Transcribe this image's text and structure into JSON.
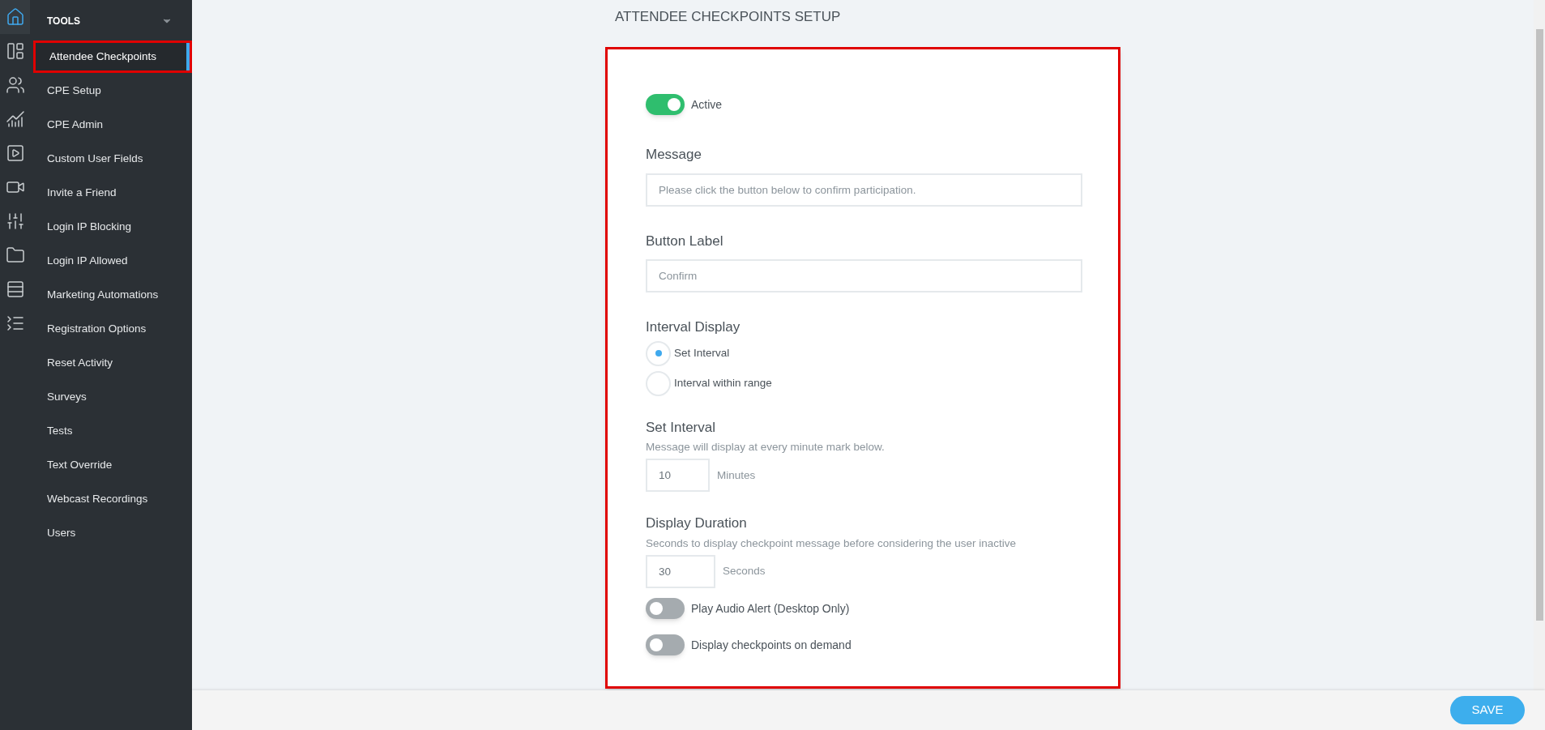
{
  "icon_rail": [
    {
      "kind": "home",
      "selected": true
    },
    {
      "kind": "layout",
      "selected": false
    },
    {
      "kind": "users",
      "selected": false
    },
    {
      "kind": "chart",
      "selected": false
    },
    {
      "kind": "media",
      "selected": false
    },
    {
      "kind": "video",
      "selected": false
    },
    {
      "kind": "sliders",
      "selected": false
    },
    {
      "kind": "folder",
      "selected": false
    },
    {
      "kind": "list",
      "selected": false
    },
    {
      "kind": "text-list",
      "selected": false
    }
  ],
  "sidebar": {
    "heading": "TOOLS",
    "items": [
      {
        "label": "Attendee Checkpoints",
        "selected": true
      },
      {
        "label": "CPE Setup",
        "selected": false
      },
      {
        "label": "CPE Admin",
        "selected": false
      },
      {
        "label": "Custom User Fields",
        "selected": false
      },
      {
        "label": "Invite a Friend",
        "selected": false
      },
      {
        "label": "Login IP Blocking",
        "selected": false
      },
      {
        "label": "Login IP Allowed",
        "selected": false
      },
      {
        "label": "Marketing Automations",
        "selected": false
      },
      {
        "label": "Registration Options",
        "selected": false
      },
      {
        "label": "Reset Activity",
        "selected": false
      },
      {
        "label": "Surveys",
        "selected": false
      },
      {
        "label": "Tests",
        "selected": false
      },
      {
        "label": "Text Override",
        "selected": false
      },
      {
        "label": "Webcast Recordings",
        "selected": false
      },
      {
        "label": "Users",
        "selected": false
      }
    ]
  },
  "page_title": "ATTENDEE CHECKPOINTS SETUP",
  "active_toggle": {
    "label": "Active",
    "on": true
  },
  "message": {
    "label": "Message",
    "placeholder": "Please click the button below to confirm participation."
  },
  "button_label": {
    "label": "Button Label",
    "placeholder": "Confirm"
  },
  "interval_display": {
    "label": "Interval Display",
    "options": [
      {
        "label": "Set Interval",
        "selected": true
      },
      {
        "label": "Interval within range",
        "selected": false
      }
    ]
  },
  "set_interval": {
    "label": "Set Interval",
    "help": "Message will display at every minute mark below.",
    "value": "10",
    "unit": "Minutes"
  },
  "display_duration": {
    "label": "Display Duration",
    "help": "Seconds to display checkpoint message before considering the user inactive",
    "value": "30",
    "unit": "Seconds"
  },
  "toggles": [
    {
      "label": "Play Audio Alert (Desktop Only)",
      "on": false
    },
    {
      "label": "Display checkpoints on demand",
      "on": false
    }
  ],
  "save_button": "SAVE"
}
